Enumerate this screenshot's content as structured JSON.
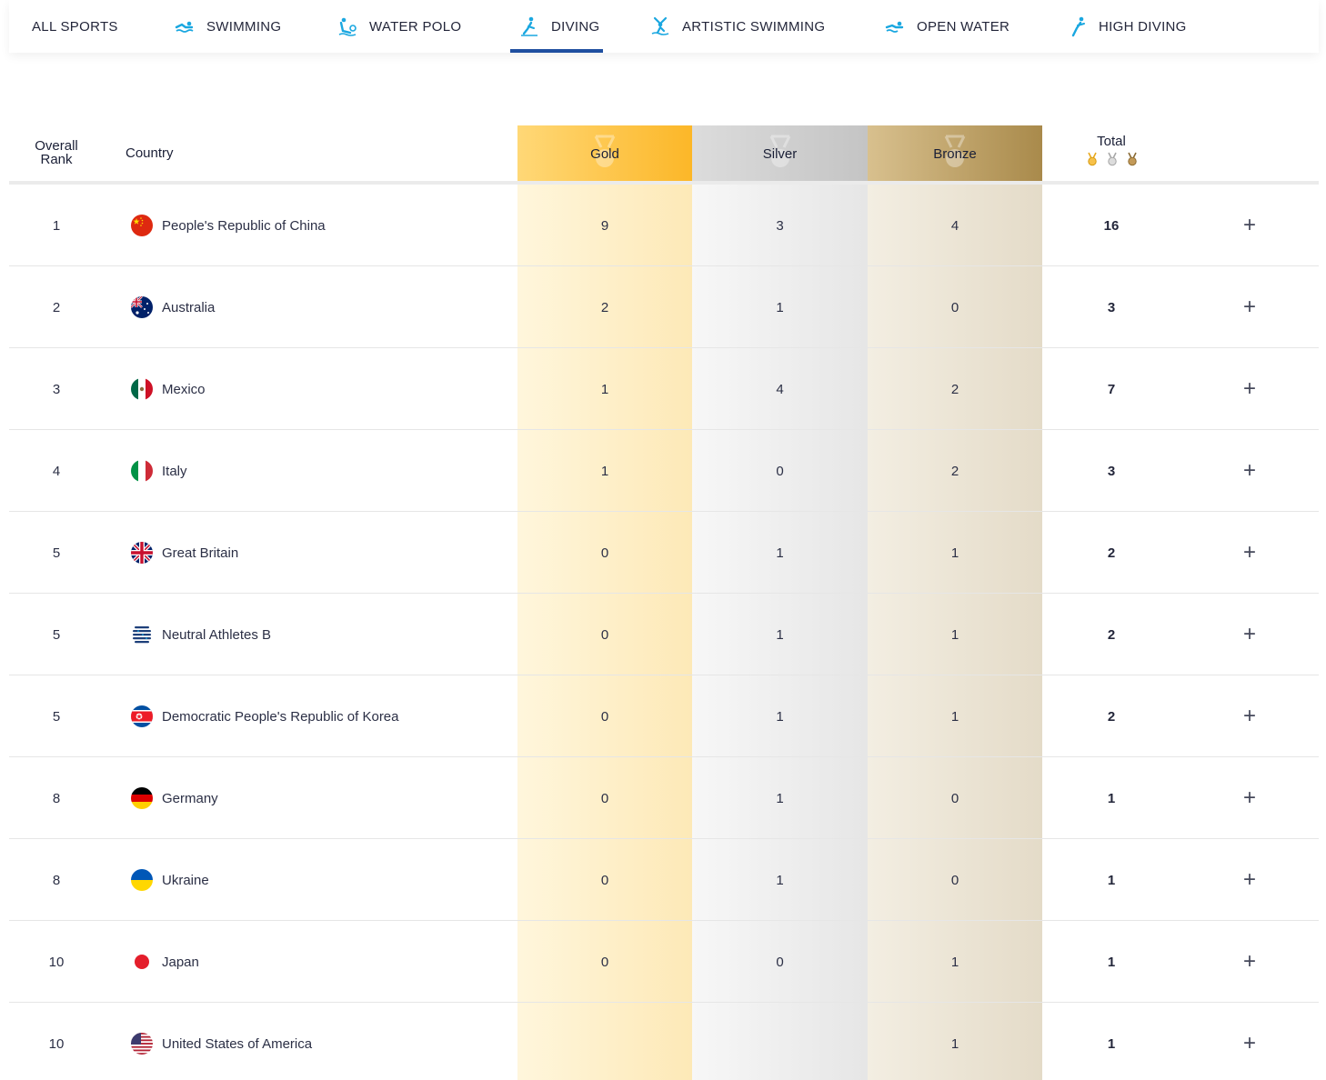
{
  "nav": {
    "items": [
      {
        "label": "ALL SPORTS",
        "icon": ""
      },
      {
        "label": "SWIMMING",
        "icon": "swimming-icon"
      },
      {
        "label": "WATER POLO",
        "icon": "water-polo-icon"
      },
      {
        "label": "DIVING",
        "icon": "diving-icon",
        "active": true
      },
      {
        "label": "ARTISTIC SWIMMING",
        "icon": "artistic-swimming-icon"
      },
      {
        "label": "OPEN WATER",
        "icon": "open-water-icon"
      },
      {
        "label": "HIGH DIVING",
        "icon": "high-diving-icon"
      }
    ]
  },
  "table": {
    "headers": {
      "rank_line1": "Overall",
      "rank_line2": "Rank",
      "country": "Country",
      "gold": "Gold",
      "silver": "Silver",
      "bronze": "Bronze",
      "total": "Total"
    },
    "expand_symbol": "+",
    "rows": [
      {
        "rank": "1",
        "country": "People's Republic of China",
        "flag": "china",
        "gold": "9",
        "silver": "3",
        "bronze": "4",
        "total": "16"
      },
      {
        "rank": "2",
        "country": "Australia",
        "flag": "australia",
        "gold": "2",
        "silver": "1",
        "bronze": "0",
        "total": "3"
      },
      {
        "rank": "3",
        "country": "Mexico",
        "flag": "mexico",
        "gold": "1",
        "silver": "4",
        "bronze": "2",
        "total": "7"
      },
      {
        "rank": "4",
        "country": "Italy",
        "flag": "italy",
        "gold": "1",
        "silver": "0",
        "bronze": "2",
        "total": "3"
      },
      {
        "rank": "5",
        "country": "Great Britain",
        "flag": "great-britain",
        "gold": "0",
        "silver": "1",
        "bronze": "1",
        "total": "2"
      },
      {
        "rank": "5",
        "country": "Neutral Athletes B",
        "flag": "neutral",
        "gold": "0",
        "silver": "1",
        "bronze": "1",
        "total": "2"
      },
      {
        "rank": "5",
        "country": "Democratic People's Republic of Korea",
        "flag": "north-korea",
        "gold": "0",
        "silver": "1",
        "bronze": "1",
        "total": "2"
      },
      {
        "rank": "8",
        "country": "Germany",
        "flag": "germany",
        "gold": "0",
        "silver": "1",
        "bronze": "0",
        "total": "1"
      },
      {
        "rank": "8",
        "country": "Ukraine",
        "flag": "ukraine",
        "gold": "0",
        "silver": "1",
        "bronze": "0",
        "total": "1"
      },
      {
        "rank": "10",
        "country": "Japan",
        "flag": "japan",
        "gold": "0",
        "silver": "0",
        "bronze": "1",
        "total": "1"
      },
      {
        "rank": "10",
        "country": "United States of America",
        "flag": "usa",
        "gold": "",
        "silver": "",
        "bronze": "1",
        "total": "1"
      }
    ]
  },
  "colors": {
    "nav_active": "#1f4fa0",
    "icon_blue": "#1aa7e0",
    "gold_header": "#fcb728",
    "silver_header": "#c4c4c4",
    "bronze_header": "#a98a4b"
  }
}
